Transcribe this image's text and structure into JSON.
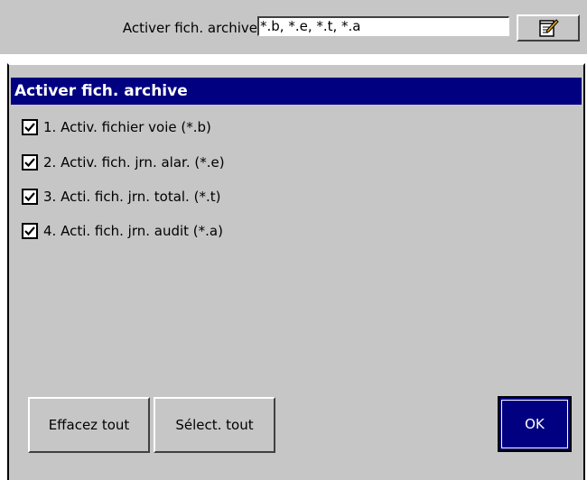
{
  "toolbar": {
    "label": "Activer fich. archive",
    "value": "*.b, *.e, *.t, *.a",
    "edit_icon": "edit-notepad-icon"
  },
  "dialog": {
    "title": "Activer fich. archive",
    "options": [
      {
        "label": "1. Activ. fichier voie (*.b)",
        "checked": true
      },
      {
        "label": "2. Activ. fich. jrn. alar. (*.e)",
        "checked": true
      },
      {
        "label": "3. Acti. fich. jrn. total. (*.t)",
        "checked": true
      },
      {
        "label": "4. Acti. fich. jrn. audit (*.a)",
        "checked": true
      }
    ],
    "buttons": {
      "clear_all": "Effacez tout",
      "select_all": "Sélect. tout",
      "ok": "OK"
    }
  },
  "colors": {
    "title_bar": "#000080",
    "panel": "#c6c6c6"
  }
}
